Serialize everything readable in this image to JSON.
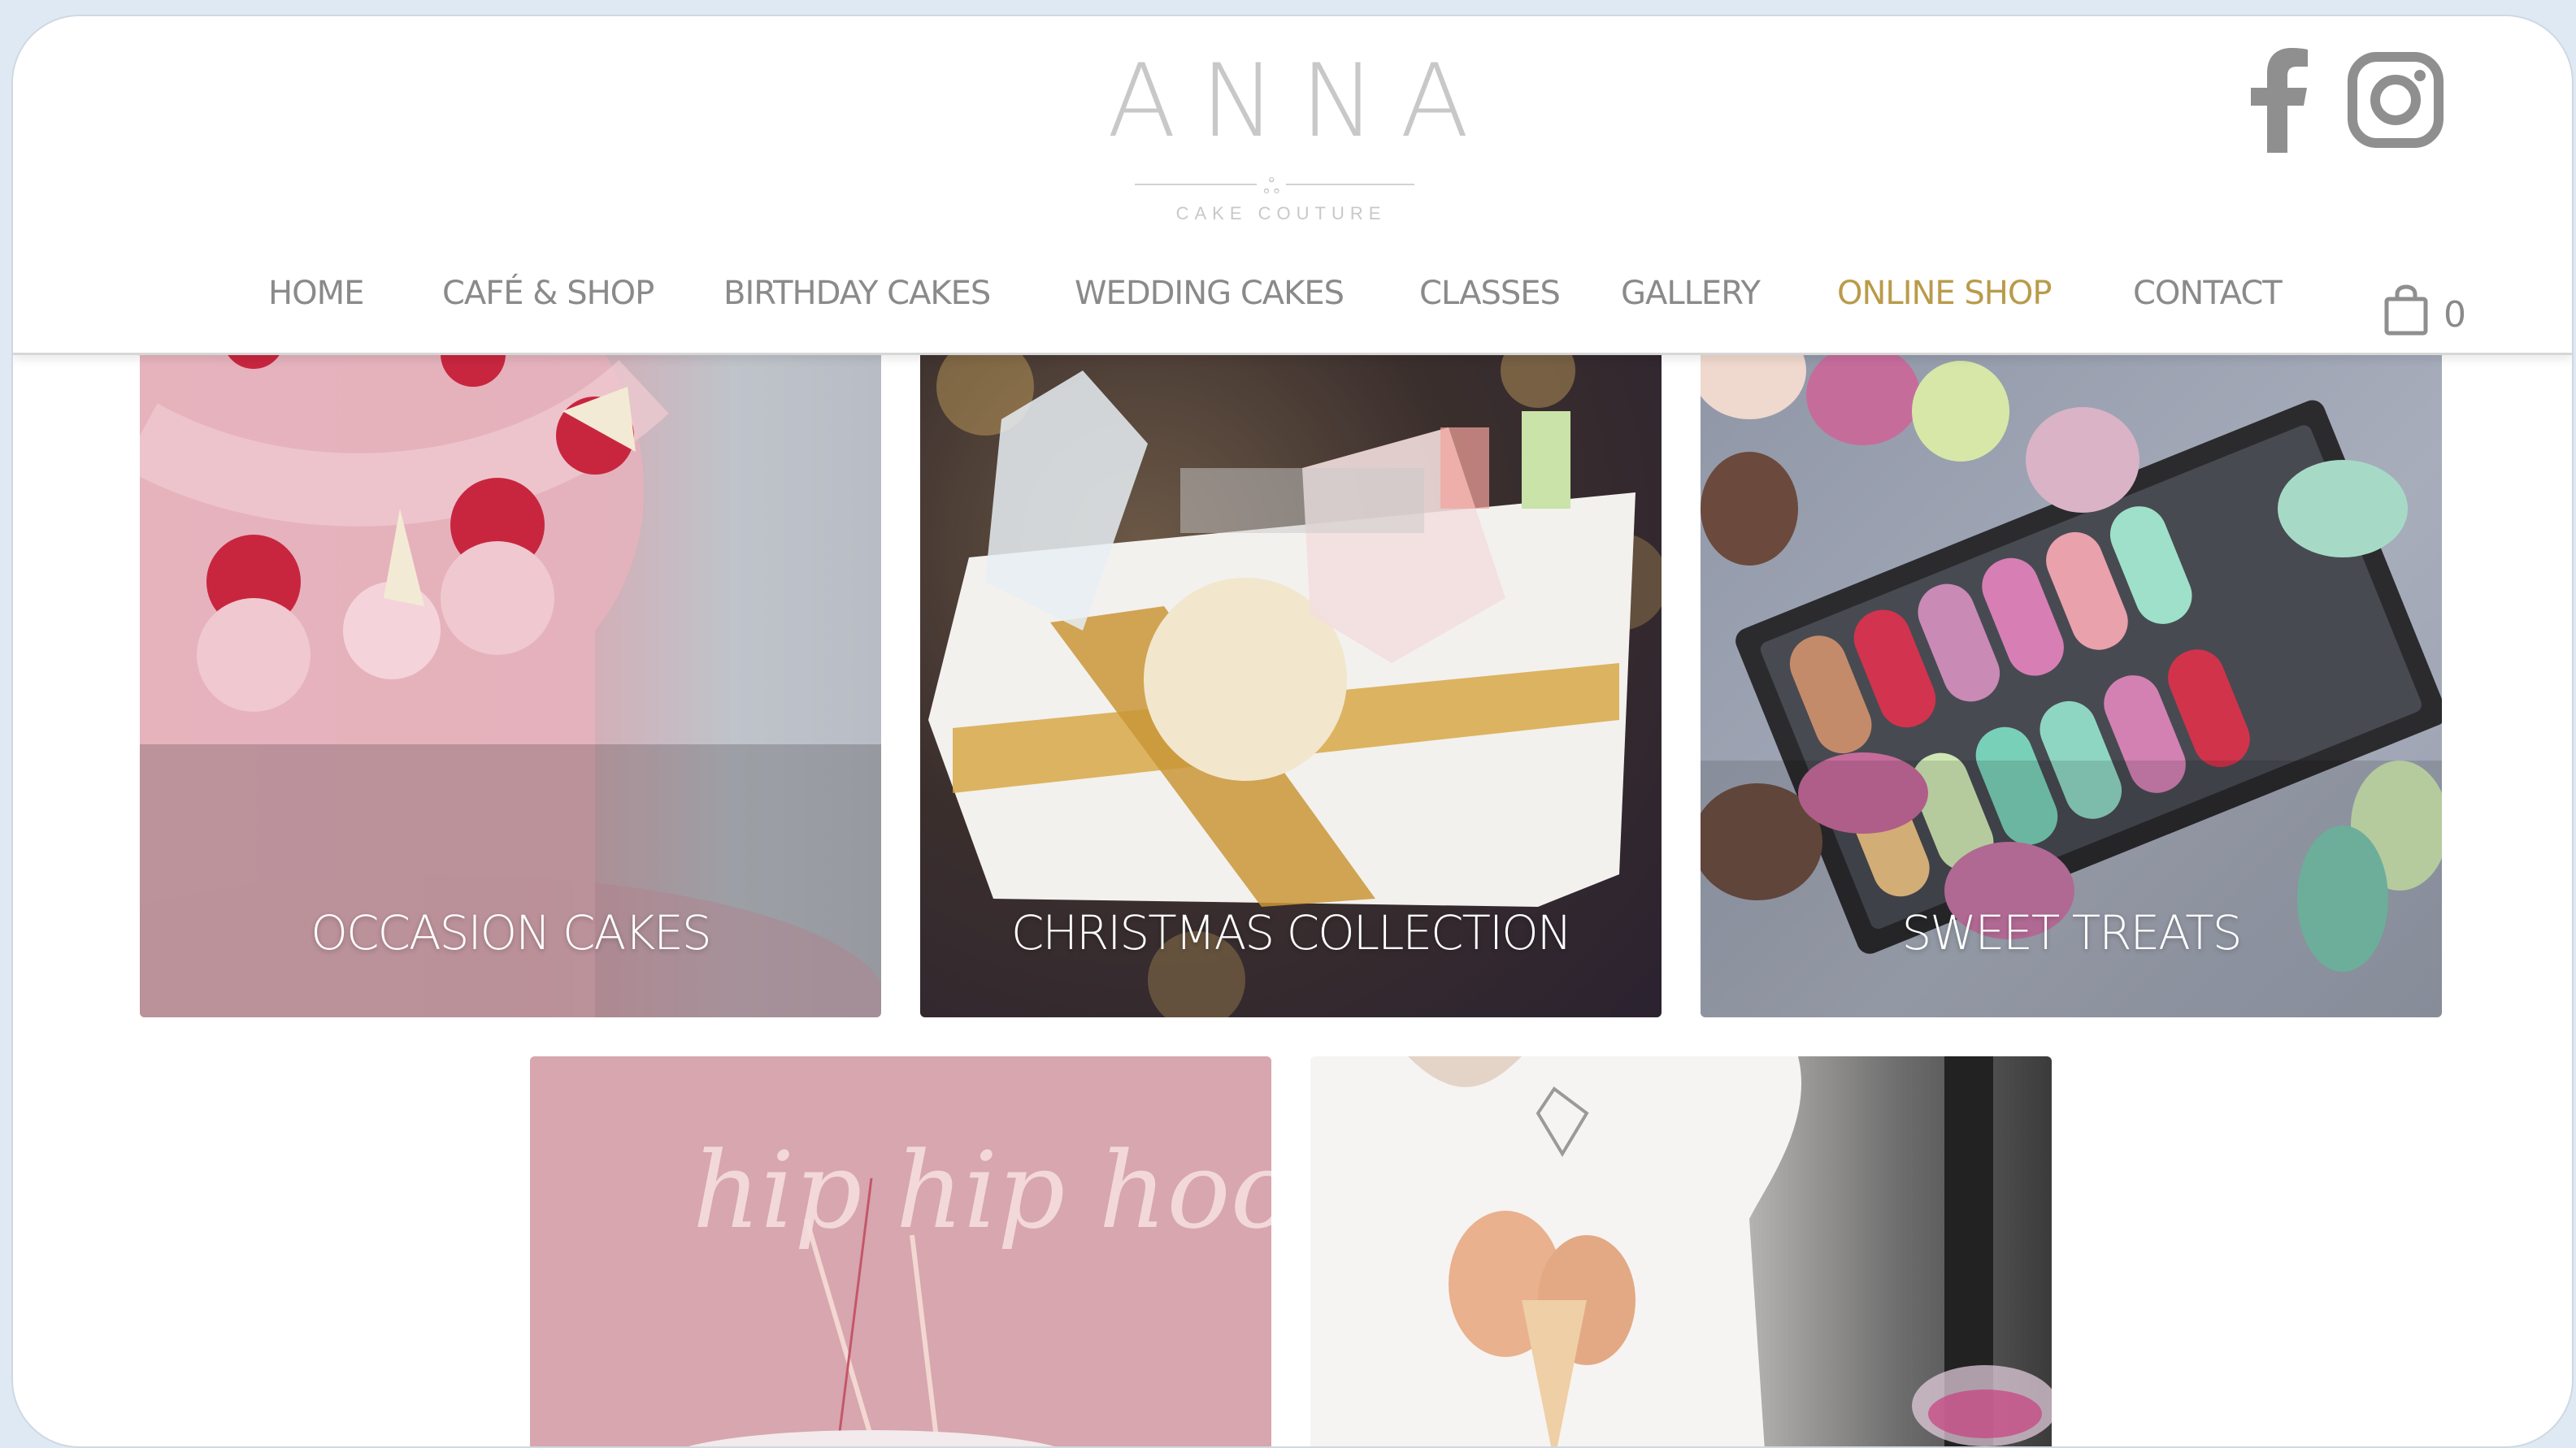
{
  "brand": {
    "name": "ANNA",
    "tagline": "CAKE COUTURE"
  },
  "social": {
    "facebook_icon": "facebook-icon",
    "instagram_icon": "instagram-icon"
  },
  "nav": {
    "items": [
      {
        "label": "HOME",
        "active": false
      },
      {
        "label": "CAFÉ & SHOP",
        "active": false
      },
      {
        "label": "BIRTHDAY CAKES",
        "active": false
      },
      {
        "label": "WEDDING CAKES",
        "active": false
      },
      {
        "label": "CLASSES",
        "active": false
      },
      {
        "label": "GALLERY",
        "active": false
      },
      {
        "label": "ONLINE SHOP",
        "active": true
      },
      {
        "label": "CONTACT",
        "active": false
      }
    ],
    "active_color": "#b99b4b",
    "text_color": "#8a8a8a"
  },
  "cart": {
    "icon": "shopping-bag-icon",
    "count": "0"
  },
  "categories": [
    {
      "label": "OCCASION CAKES"
    },
    {
      "label": "CHRISTMAS COLLECTION"
    },
    {
      "label": "SWEET TREATS"
    },
    {
      "label": ""
    },
    {
      "label": ""
    }
  ],
  "tile4_image_text": "hip hip hooray"
}
